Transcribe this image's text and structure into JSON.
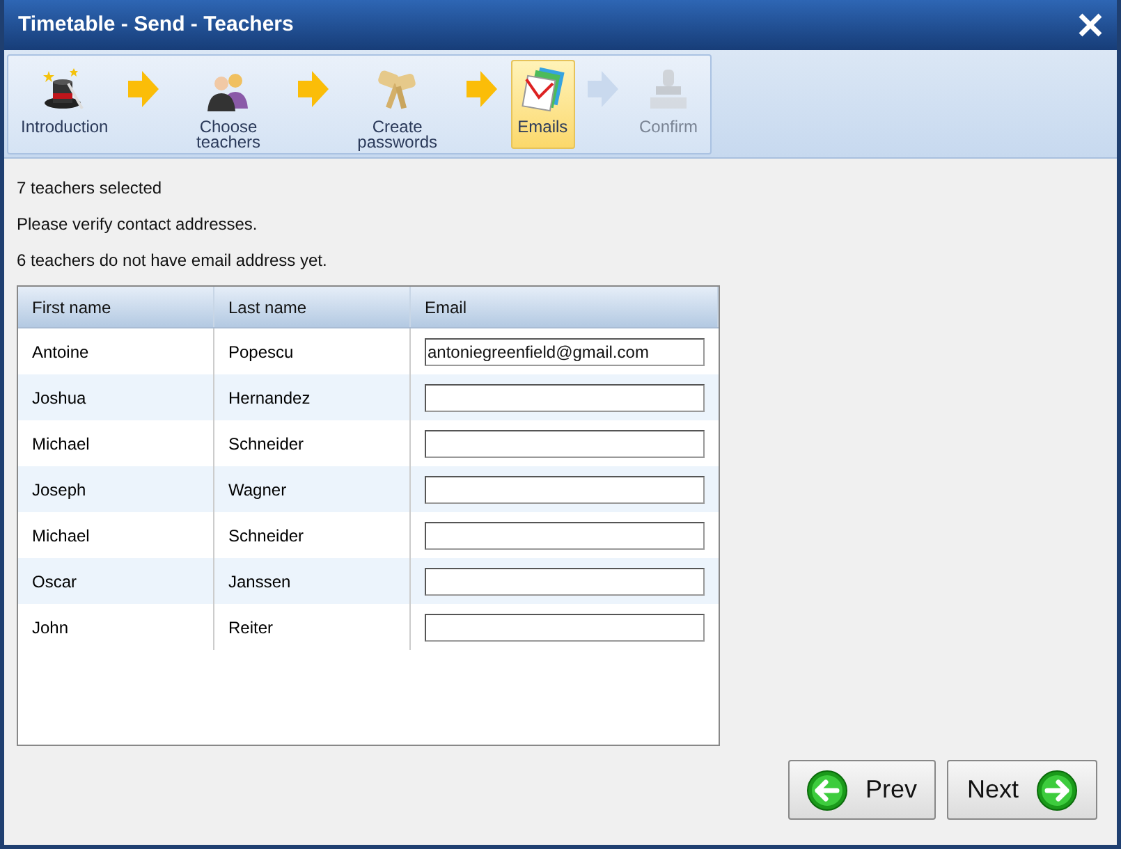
{
  "window": {
    "title": "Timetable - Send - Teachers"
  },
  "steps": [
    {
      "kind": "wizard",
      "label": "Introduction",
      "selected": false,
      "disabled": false
    },
    {
      "kind": "people",
      "label": "Choose teachers",
      "selected": false,
      "disabled": false
    },
    {
      "kind": "keys",
      "label": "Create passwords",
      "selected": false,
      "disabled": false
    },
    {
      "kind": "mail",
      "label": "Emails",
      "selected": true,
      "disabled": false
    },
    {
      "kind": "stamp",
      "label": "Confirm",
      "selected": false,
      "disabled": true
    }
  ],
  "messages": [
    "7 teachers selected",
    "Please verify contact addresses.",
    "6 teachers do not have email address yet."
  ],
  "table": {
    "columns": [
      "First name",
      "Last name",
      "Email"
    ],
    "rows": [
      {
        "first": "Antoine",
        "last": "Popescu",
        "email": "antoniegreenfield@gmail.com"
      },
      {
        "first": "Joshua",
        "last": "Hernandez",
        "email": ""
      },
      {
        "first": "Michael",
        "last": "Schneider",
        "email": ""
      },
      {
        "first": "Joseph",
        "last": "Wagner",
        "email": ""
      },
      {
        "first": "Michael",
        "last": "Schneider",
        "email": ""
      },
      {
        "first": "Oscar",
        "last": "Janssen",
        "email": ""
      },
      {
        "first": "John",
        "last": "Reiter",
        "email": ""
      }
    ]
  },
  "buttons": {
    "prev": "Prev",
    "next": "Next"
  }
}
